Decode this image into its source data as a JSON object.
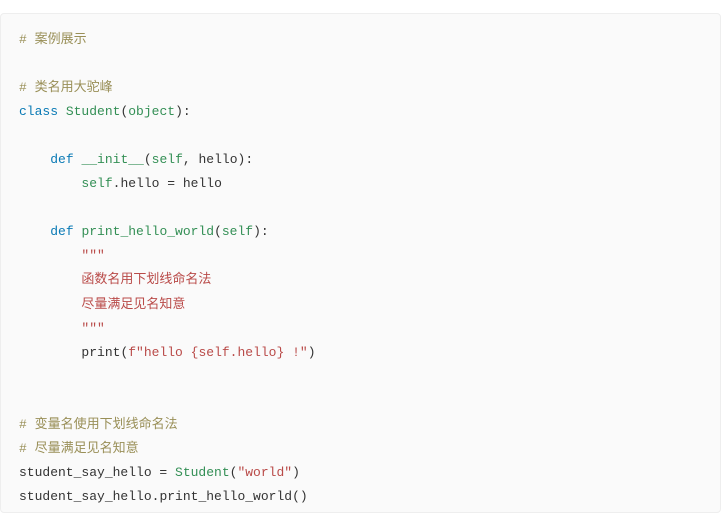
{
  "code": {
    "c1": "# 案例展示",
    "c2": "# 类名用大驼峰",
    "kw_class": "class",
    "cls_name": "Student",
    "obj": "object",
    "kw_def": "def",
    "init": "__init__",
    "self": "self",
    "param_hello": "hello",
    "assign_lhs_self": "self",
    "assign_lhs_attr": "hello",
    "eq": " = ",
    "assign_rhs": "hello",
    "fn2": "print_hello_world",
    "tq": "\"\"\"",
    "doc1": "函数名用下划线命名法",
    "doc2": "尽量满足见名知意",
    "print": "print",
    "fstr": "f\"hello {self.hello} !\"",
    "c3": "# 变量名使用下划线命名法",
    "c4": "# 尽量满足见名知意",
    "var": "student_say_hello",
    "ctor": "Student",
    "arg_world": "\"world\"",
    "call_obj": "student_say_hello",
    "call_fn": "print_hello_world"
  }
}
